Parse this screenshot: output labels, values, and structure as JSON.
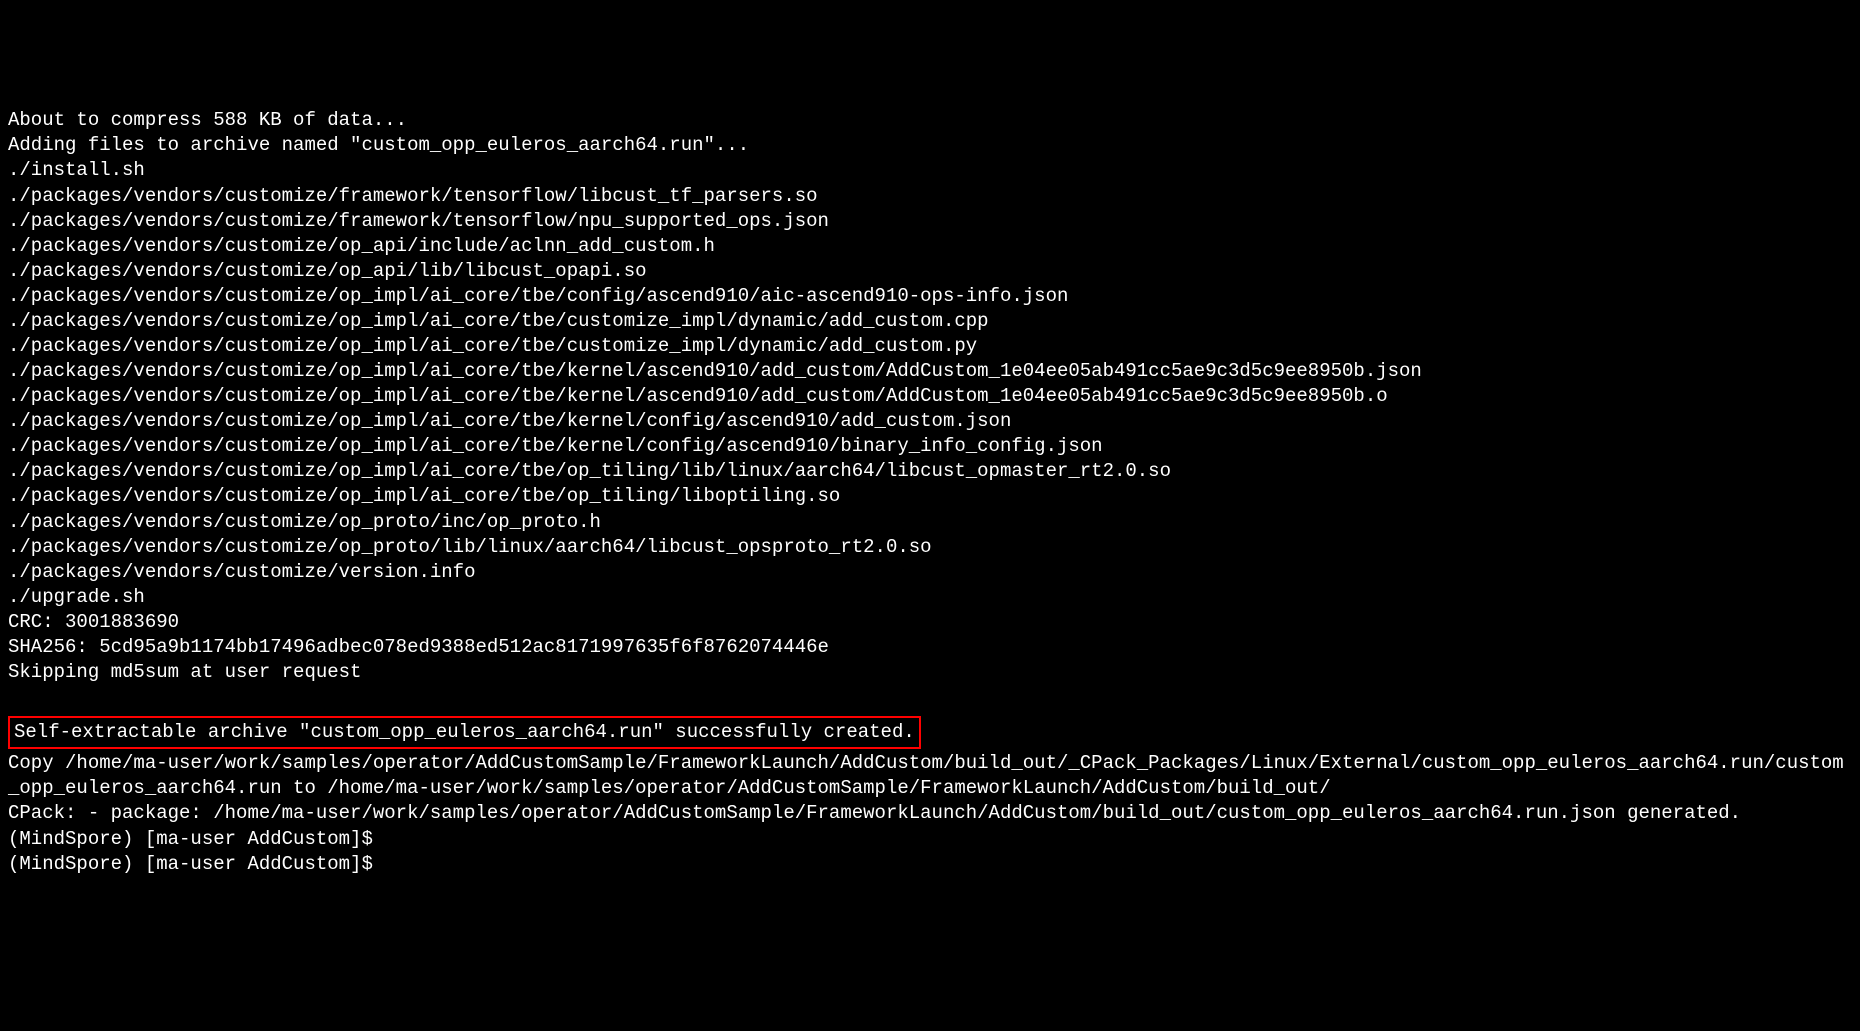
{
  "terminal": {
    "lines": [
      "About to compress 588 KB of data...",
      "Adding files to archive named \"custom_opp_euleros_aarch64.run\"...",
      "./install.sh",
      "./packages/vendors/customize/framework/tensorflow/libcust_tf_parsers.so",
      "./packages/vendors/customize/framework/tensorflow/npu_supported_ops.json",
      "./packages/vendors/customize/op_api/include/aclnn_add_custom.h",
      "./packages/vendors/customize/op_api/lib/libcust_opapi.so",
      "./packages/vendors/customize/op_impl/ai_core/tbe/config/ascend910/aic-ascend910-ops-info.json",
      "./packages/vendors/customize/op_impl/ai_core/tbe/customize_impl/dynamic/add_custom.cpp",
      "./packages/vendors/customize/op_impl/ai_core/tbe/customize_impl/dynamic/add_custom.py",
      "./packages/vendors/customize/op_impl/ai_core/tbe/kernel/ascend910/add_custom/AddCustom_1e04ee05ab491cc5ae9c3d5c9ee8950b.json",
      "./packages/vendors/customize/op_impl/ai_core/tbe/kernel/ascend910/add_custom/AddCustom_1e04ee05ab491cc5ae9c3d5c9ee8950b.o",
      "./packages/vendors/customize/op_impl/ai_core/tbe/kernel/config/ascend910/add_custom.json",
      "./packages/vendors/customize/op_impl/ai_core/tbe/kernel/config/ascend910/binary_info_config.json",
      "./packages/vendors/customize/op_impl/ai_core/tbe/op_tiling/lib/linux/aarch64/libcust_opmaster_rt2.0.so",
      "./packages/vendors/customize/op_impl/ai_core/tbe/op_tiling/liboptiling.so",
      "./packages/vendors/customize/op_proto/inc/op_proto.h",
      "./packages/vendors/customize/op_proto/lib/linux/aarch64/libcust_opsproto_rt2.0.so",
      "./packages/vendors/customize/version.info",
      "./upgrade.sh",
      "CRC: 3001883690",
      "SHA256: 5cd95a9b1174bb17496adbec078ed9388ed512ac8171997635f6f8762074446e",
      "Skipping md5sum at user request"
    ],
    "highlighted_line": "Self-extractable archive \"custom_opp_euleros_aarch64.run\" successfully created.",
    "trailing_lines": [
      "Copy /home/ma-user/work/samples/operator/AddCustomSample/FrameworkLaunch/AddCustom/build_out/_CPack_Packages/Linux/External/custom_opp_euleros_aarch64.run/custom_opp_euleros_aarch64.run to /home/ma-user/work/samples/operator/AddCustomSample/FrameworkLaunch/AddCustom/build_out/",
      "CPack: - package: /home/ma-user/work/samples/operator/AddCustomSample/FrameworkLaunch/AddCustom/build_out/custom_opp_euleros_aarch64.run.json generated.",
      "(MindSpore) [ma-user AddCustom]$",
      "(MindSpore) [ma-user AddCustom]$"
    ]
  }
}
